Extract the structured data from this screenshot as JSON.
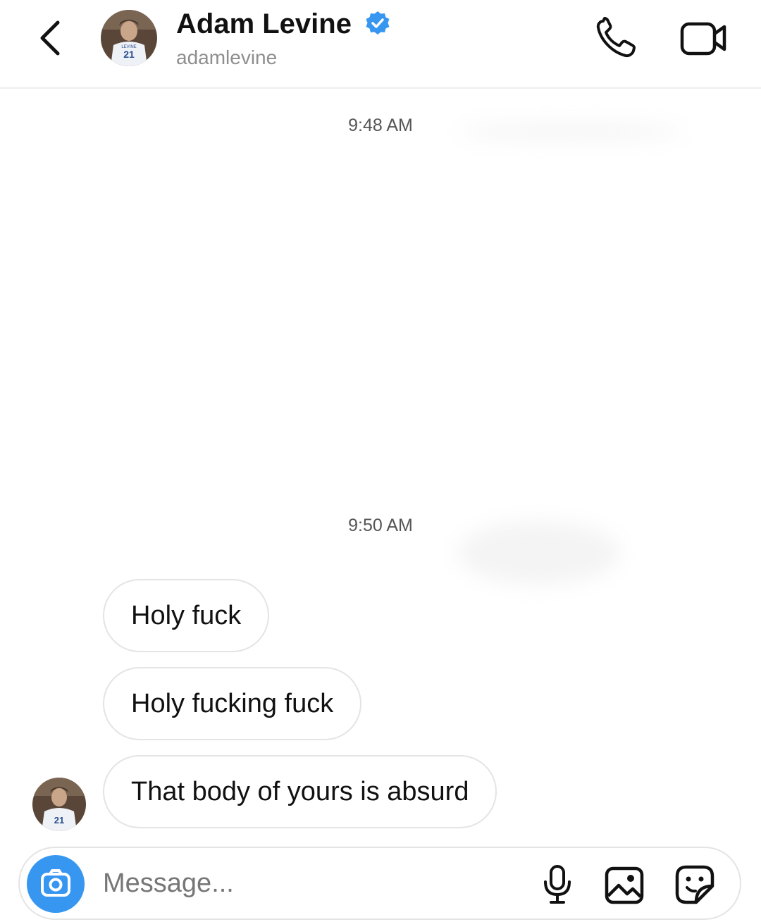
{
  "header": {
    "name": "Adam Levine",
    "handle": "adamlevine",
    "verified": true,
    "icons": {
      "back": "chevron-left-icon",
      "verified": "verified-badge-icon",
      "call": "phone-icon",
      "video": "video-camera-icon"
    }
  },
  "thread": {
    "timestamps": [
      "9:48 AM",
      "9:50 AM"
    ],
    "messages": [
      {
        "text": "Holy fuck",
        "from": "other"
      },
      {
        "text": "Holy fucking fuck",
        "from": "other"
      },
      {
        "text": "That body of yours is absurd",
        "from": "other"
      }
    ]
  },
  "composer": {
    "placeholder": "Message...",
    "icons": {
      "camera": "camera-icon",
      "mic": "microphone-icon",
      "gallery": "image-icon",
      "sticker": "sticker-icon"
    }
  },
  "colors": {
    "accent_blue": "#3797f0",
    "verified_blue": "#3797f0",
    "bubble_border": "#e4e4e4",
    "secondary_text": "#8e8e8e"
  }
}
